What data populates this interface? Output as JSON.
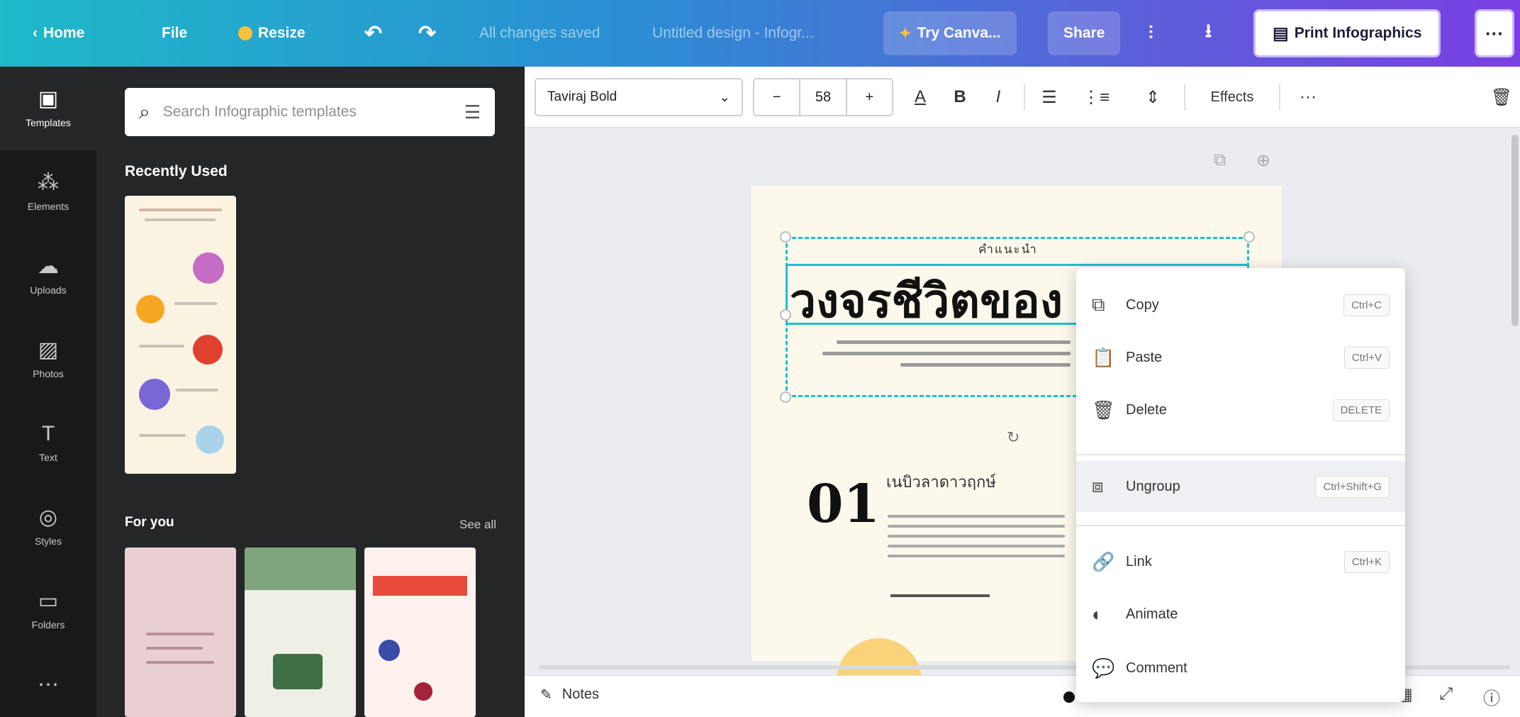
{
  "topbar": {
    "home": "Home",
    "file": "File",
    "resize": "Resize",
    "status": "All changes saved",
    "doc_title": "Untitled design - Infogr...",
    "try_canva": "Try Canva...",
    "share": "Share",
    "print": "Print Infographics",
    "more": "···",
    "brand_gradient": [
      "#1fb9c9",
      "#7b3fe4"
    ]
  },
  "rail": {
    "items": [
      {
        "label": "Templates",
        "icon": "templates-icon"
      },
      {
        "label": "Elements",
        "icon": "elements-icon"
      },
      {
        "label": "Uploads",
        "icon": "uploads-icon"
      },
      {
        "label": "Photos",
        "icon": "photos-icon"
      },
      {
        "label": "Text",
        "icon": "text-icon"
      },
      {
        "label": "Styles",
        "icon": "styles-icon"
      },
      {
        "label": "Folders",
        "icon": "folders-icon"
      }
    ]
  },
  "panel": {
    "search_placeholder": "Search Infographic templates",
    "recently_used": "Recently Used",
    "for_you": "For you",
    "see_all": "See all"
  },
  "toolbar": {
    "font": "Taviraj Bold",
    "font_size": "58",
    "minus": "−",
    "plus": "+",
    "effects": "Effects",
    "more": "···"
  },
  "canvas": {
    "kicker": "คำแนะนำ",
    "headline": "วงจรชีวิตของ",
    "section_number": "01",
    "section_title": "เนบิวลาดาวฤกษ์"
  },
  "bottom": {
    "notes": "Notes"
  },
  "context_menu": {
    "items": [
      {
        "label": "Copy",
        "shortcut": "Ctrl+C",
        "icon": "copy-icon"
      },
      {
        "label": "Paste",
        "shortcut": "Ctrl+V",
        "icon": "paste-icon"
      },
      {
        "label": "Delete",
        "shortcut": "DELETE",
        "icon": "trash-icon"
      },
      {
        "label": "Ungroup",
        "shortcut": "Ctrl+Shift+G",
        "icon": "ungroup-icon"
      },
      {
        "label": "Link",
        "shortcut": "Ctrl+K",
        "icon": "link-icon"
      },
      {
        "label": "Animate",
        "shortcut": "",
        "icon": "animate-icon"
      },
      {
        "label": "Comment",
        "shortcut": "",
        "icon": "comment-icon"
      }
    ]
  }
}
